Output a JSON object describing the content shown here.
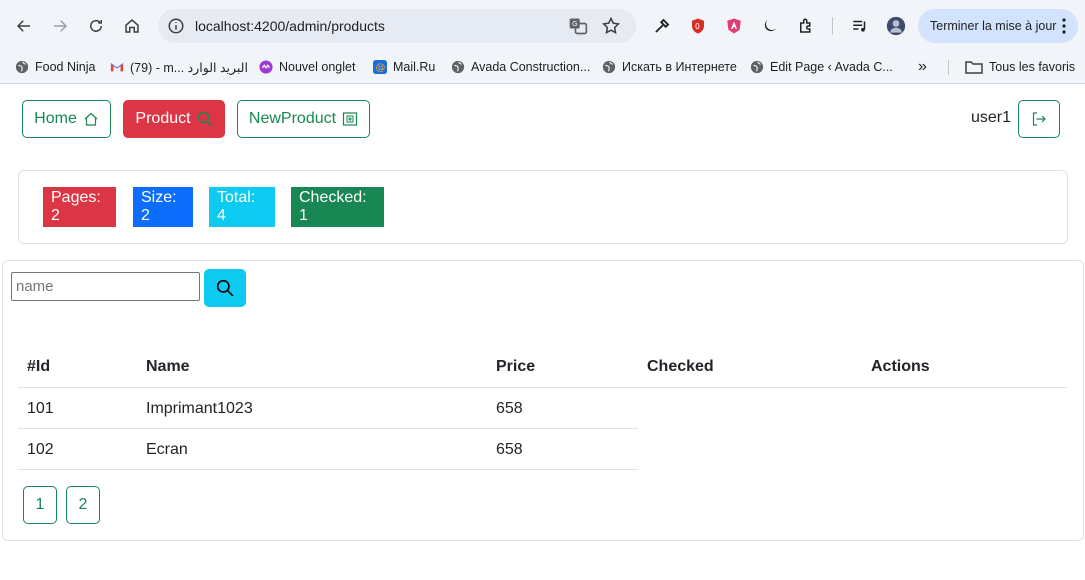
{
  "browser": {
    "url": "localhost:4200/admin/products",
    "update_label": "Terminer la mise à jour",
    "bookmarks": [
      {
        "label": "Food Ninja",
        "icon": "globe-icon"
      },
      {
        "label": "(79) - m... البريد الوارد",
        "icon": "gmail-icon"
      },
      {
        "label": "Nouvel onglet",
        "icon": "new-tab-icon"
      },
      {
        "label": "Mail.Ru",
        "icon": "mailru-icon"
      },
      {
        "label": "Avada Construction...",
        "icon": "globe-icon"
      },
      {
        "label": "Искать в Интернете",
        "icon": "globe-icon"
      },
      {
        "label": "Edit Page ‹ Avada C...",
        "icon": "globe-icon"
      }
    ],
    "more_bookmarks": "»",
    "all_bookmarks": "Tous les favoris"
  },
  "nav": {
    "home": "Home",
    "product": "Product",
    "new_product": "NewProduct",
    "user": "user1"
  },
  "stats": {
    "pages": "Pages: 2",
    "size": "Size: 2",
    "total": "Total: 4",
    "checked": "Checked: 1"
  },
  "search": {
    "placeholder": "name"
  },
  "table": {
    "headers": [
      "#Id",
      "Name",
      "Price",
      "Checked",
      "Actions"
    ],
    "rows": [
      {
        "id": "101",
        "name": "Imprimant1023",
        "price": "658"
      },
      {
        "id": "102",
        "name": "Ecran",
        "price": "658"
      }
    ]
  },
  "pagination": [
    "1",
    "2"
  ],
  "colors": {
    "primary": "#0d6efd",
    "danger": "#dc3545",
    "info": "#0dcaf0",
    "success": "#198754"
  }
}
